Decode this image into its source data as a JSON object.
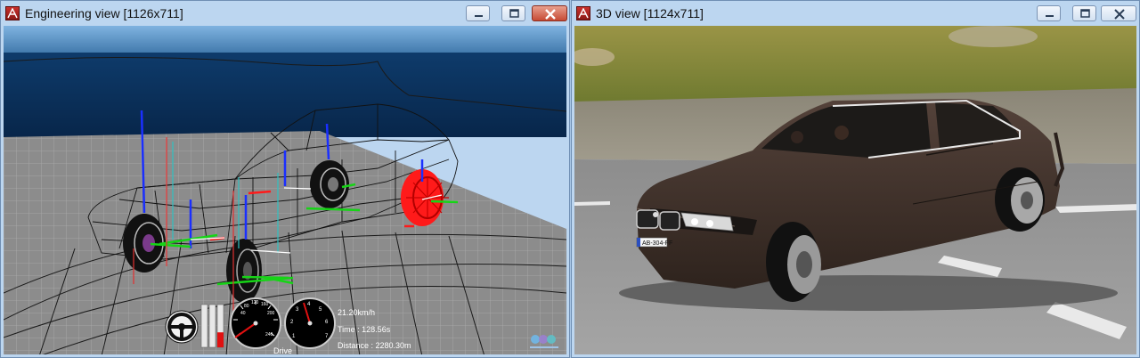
{
  "engineering_window": {
    "title": "Engineering view [1126x711]",
    "hud": {
      "speed": "21.20km/h",
      "time": "Time : 128.56s",
      "distance": "Distance : 2280.30m",
      "gear": "Drive",
      "speedo_ticks": [
        "40",
        "80",
        "120",
        "160",
        "200",
        "240"
      ],
      "tacho_ticks": [
        "1",
        "2",
        "3",
        "4",
        "5",
        "6",
        "7"
      ],
      "throttle_level": 0.35
    }
  },
  "view3d_window": {
    "title": "3D view [1124x711]",
    "license_plate": "AB-304-FF"
  },
  "colors": {
    "sky": "#4a86b8",
    "sea": "#0c2f57",
    "ground": "#8d8d8d",
    "selected_wheel": "#ff1a1a",
    "car_body": "#3d2e26",
    "grass": "#8e8a3c",
    "road": "#9a9a9a"
  }
}
